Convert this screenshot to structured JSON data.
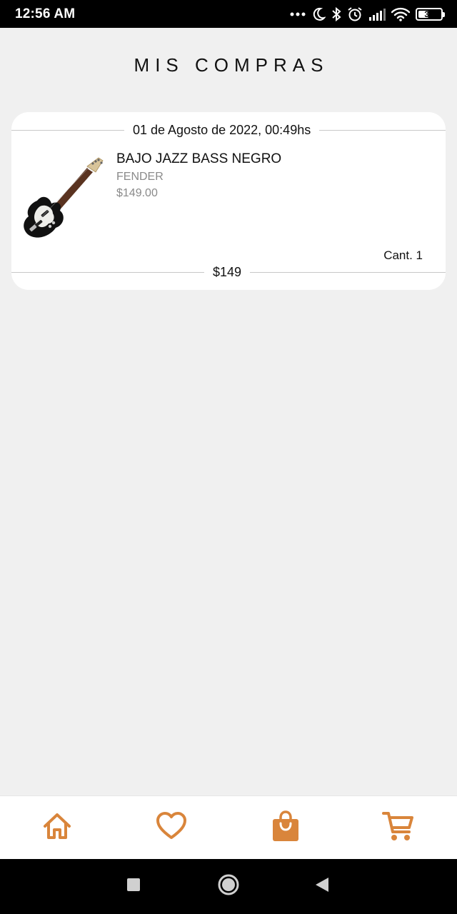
{
  "status_bar": {
    "time": "12:56 AM",
    "battery": "39",
    "icons": [
      "more-dots-icon",
      "moon-icon",
      "bluetooth-icon",
      "alarm-icon",
      "signal-icon",
      "wifi-icon",
      "battery-icon"
    ]
  },
  "header": {
    "title": "MIS COMPRAS"
  },
  "order": {
    "date": "01 de Agosto de 2022,  00:49hs",
    "item": {
      "name": "BAJO JAZZ BASS NEGRO",
      "brand": "FENDER",
      "price": "$149.00",
      "quantity": "Cant. 1",
      "image": "bass-guitar-image"
    },
    "total": "$149"
  },
  "bottom_nav": {
    "accent_color": "#d9853b",
    "items": [
      {
        "icon": "home-icon"
      },
      {
        "icon": "heart-icon"
      },
      {
        "icon": "shopping-bag-icon",
        "active": true
      },
      {
        "icon": "cart-icon"
      }
    ]
  },
  "system_nav": {
    "icons": [
      "recent-apps-icon",
      "home-circle-icon",
      "back-icon"
    ]
  }
}
